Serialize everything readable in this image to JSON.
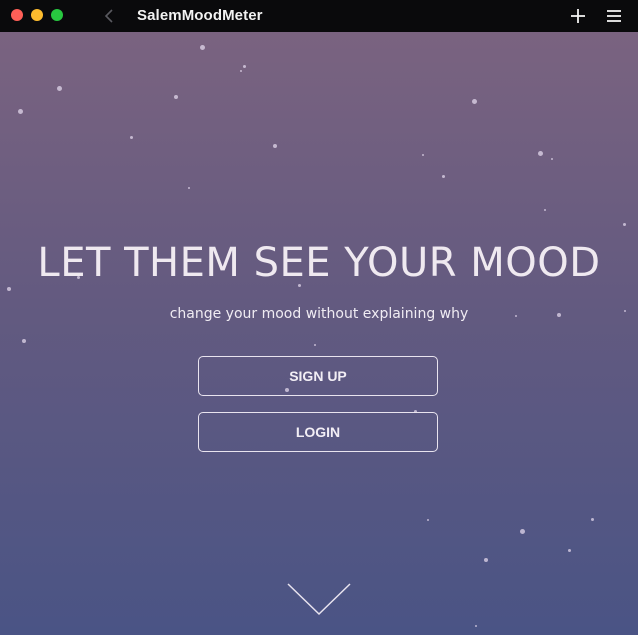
{
  "window": {
    "title": "SalemMoodMeter"
  },
  "hero": {
    "headline": "LET THEM SEE YOUR MOOD",
    "subtitle": "change your mood without explaining why",
    "signup_label": "SIGN UP",
    "login_label": "LOGIN"
  },
  "icons": {
    "back": "chevron-left-icon",
    "add": "plus-icon",
    "menu": "hamburger-menu-icon",
    "scroll": "chevron-down-icon"
  },
  "colors": {
    "gradient_top": "#7a6380",
    "gradient_bottom": "#4a5485",
    "titlebar": "#0a0a0c"
  }
}
